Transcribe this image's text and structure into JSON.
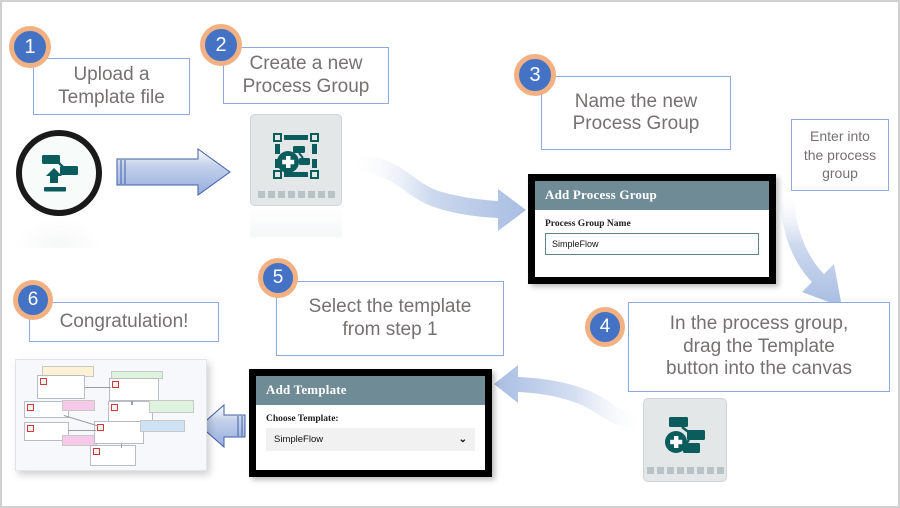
{
  "diagram": {
    "title": "NiFi template upload and process group walkthrough",
    "accent_blue": "#4472c4",
    "accent_orange": "#f2b183",
    "callout_border": "#8faadc",
    "callout_text": "#767171",
    "dialog_header": "#6f8b96",
    "icon_teal": "#0b5c5c"
  },
  "steps": [
    {
      "number": "1",
      "text": "Upload a\nTemplate file"
    },
    {
      "number": "2",
      "text": "Create a new\nProcess Group"
    },
    {
      "number": "3",
      "text": "Name the new\nProcess Group"
    },
    {
      "number": "4",
      "text": "In the process group,\ndrag the Template\nbutton into the canvas"
    },
    {
      "number": "5",
      "text": "Select the template\nfrom step 1"
    },
    {
      "number": "6",
      "text": "Congratulation!"
    }
  ],
  "notes": {
    "enter_process_group": "Enter into\nthe process\ngroup"
  },
  "dialogs": {
    "add_process_group": {
      "title": "Add Process Group",
      "field_label": "Process Group Name",
      "field_value": "SimpleFlow"
    },
    "add_template": {
      "title": "Add Template",
      "field_label": "Choose Template:",
      "selected_option": "SimpleFlow",
      "chevron": "⌄"
    }
  },
  "icons": {
    "upload_template": "upload-template-icon",
    "add_process_group": "add-process-group-icon",
    "add_template_button": "add-template-button-icon",
    "flow_thumbnail": "flow-canvas-thumbnail"
  },
  "arrows": [
    {
      "name": "arrow-step1-to-step2",
      "style": "straight-block-right"
    },
    {
      "name": "arrow-step2-to-dialog",
      "style": "curved-right"
    },
    {
      "name": "arrow-dialog-to-step4",
      "style": "curved-down"
    },
    {
      "name": "arrow-step4-to-add-template",
      "style": "curved-left"
    },
    {
      "name": "arrow-add-template-to-result",
      "style": "straight-block-left"
    }
  ]
}
